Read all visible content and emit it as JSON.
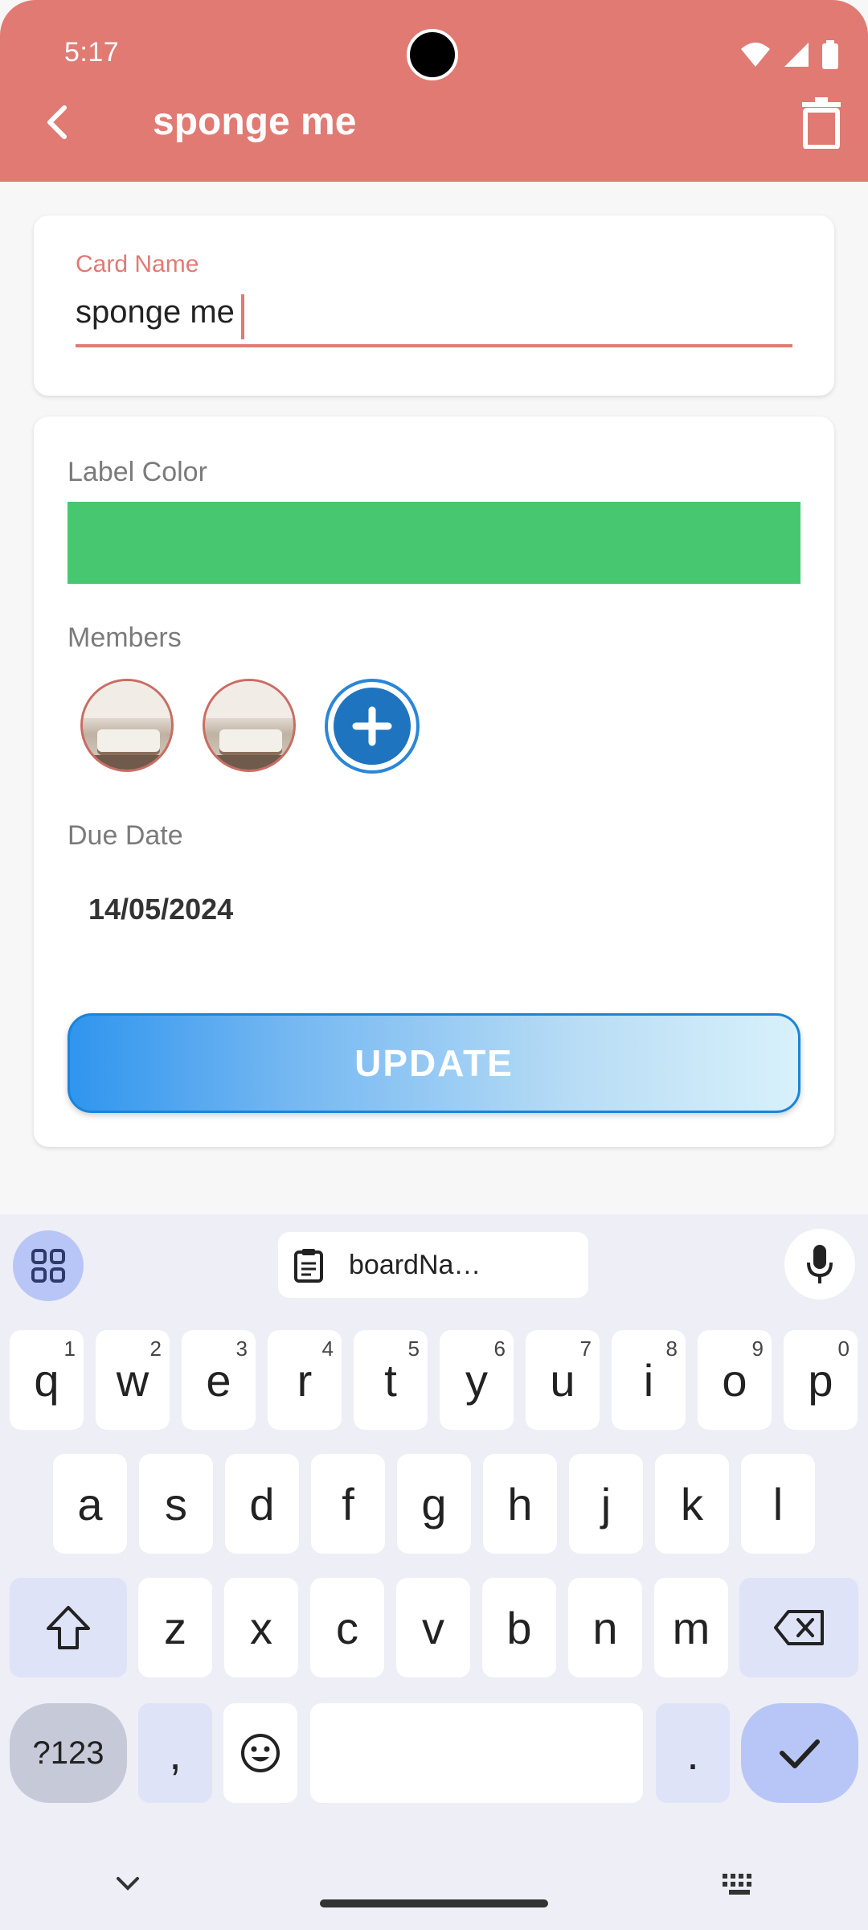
{
  "status_bar": {
    "time": "5:17"
  },
  "app_bar": {
    "title": "sponge me"
  },
  "card_name": {
    "label": "Card Name",
    "value": "sponge me"
  },
  "details": {
    "label_color_title": "Label Color",
    "label_color": "#47c870",
    "members_title": "Members",
    "due_date_title": "Due Date",
    "due_date": "14/05/2024",
    "update_label": "UPDATE"
  },
  "keyboard": {
    "clipboard_text": "boardNa…",
    "row1": [
      {
        "k": "q",
        "s": "1"
      },
      {
        "k": "w",
        "s": "2"
      },
      {
        "k": "e",
        "s": "3"
      },
      {
        "k": "r",
        "s": "4"
      },
      {
        "k": "t",
        "s": "5"
      },
      {
        "k": "y",
        "s": "6"
      },
      {
        "k": "u",
        "s": "7"
      },
      {
        "k": "i",
        "s": "8"
      },
      {
        "k": "o",
        "s": "9"
      },
      {
        "k": "p",
        "s": "0"
      }
    ],
    "row2": [
      "a",
      "s",
      "d",
      "f",
      "g",
      "h",
      "j",
      "k",
      "l"
    ],
    "row3": [
      "z",
      "x",
      "c",
      "v",
      "b",
      "n",
      "m"
    ],
    "symbols_label": "?123",
    "comma": ",",
    "period": "."
  },
  "colors": {
    "app_bar": "#e07a73",
    "accent": "#e07a73",
    "button_blue": "#2f95ee"
  }
}
